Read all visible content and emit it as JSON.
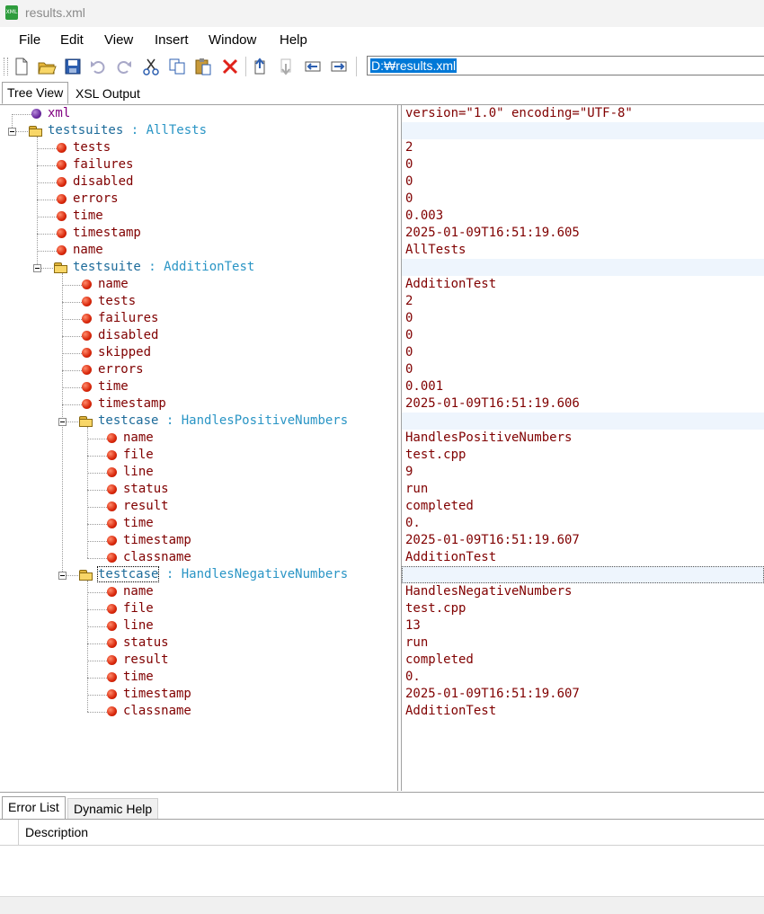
{
  "window": {
    "title": "results.xml",
    "icon": "xml-file-icon"
  },
  "menu": [
    "File",
    "Edit",
    "View",
    "Insert",
    "Window",
    "Help"
  ],
  "toolbar": {
    "buttons": [
      "new-file-icon",
      "open-folder-icon",
      "save-icon",
      "undo-icon",
      "redo-icon",
      "cut-icon",
      "copy-icon",
      "paste-icon",
      "delete-icon",
      "move-up-icon",
      "move-down-icon",
      "outdent-icon",
      "indent-icon"
    ],
    "path": "D:₩results.xml"
  },
  "tabs": {
    "tree_view": "Tree View",
    "xsl_output": "XSL Output"
  },
  "tree": [
    {
      "kind": "pi",
      "name": "xml",
      "type": "",
      "value": "version=\"1.0\" encoding=\"UTF-8\"",
      "level": 0
    },
    {
      "kind": "elem",
      "name": "testsuites",
      "type": ": AllTests",
      "value": "",
      "level": 0
    },
    {
      "kind": "attr",
      "name": "tests",
      "value": "2",
      "level": 1
    },
    {
      "kind": "attr",
      "name": "failures",
      "value": "0",
      "level": 1
    },
    {
      "kind": "attr",
      "name": "disabled",
      "value": "0",
      "level": 1
    },
    {
      "kind": "attr",
      "name": "errors",
      "value": "0",
      "level": 1
    },
    {
      "kind": "attr",
      "name": "time",
      "value": "0.003",
      "level": 1
    },
    {
      "kind": "attr",
      "name": "timestamp",
      "value": "2025-01-09T16:51:19.605",
      "level": 1
    },
    {
      "kind": "attr",
      "name": "name",
      "value": "AllTests",
      "level": 1
    },
    {
      "kind": "elem",
      "name": "testsuite",
      "type": ": AdditionTest",
      "value": "",
      "level": 1
    },
    {
      "kind": "attr",
      "name": "name",
      "value": "AdditionTest",
      "level": 2
    },
    {
      "kind": "attr",
      "name": "tests",
      "value": "2",
      "level": 2
    },
    {
      "kind": "attr",
      "name": "failures",
      "value": "0",
      "level": 2
    },
    {
      "kind": "attr",
      "name": "disabled",
      "value": "0",
      "level": 2
    },
    {
      "kind": "attr",
      "name": "skipped",
      "value": "0",
      "level": 2
    },
    {
      "kind": "attr",
      "name": "errors",
      "value": "0",
      "level": 2
    },
    {
      "kind": "attr",
      "name": "time",
      "value": "0.001",
      "level": 2
    },
    {
      "kind": "attr",
      "name": "timestamp",
      "value": "2025-01-09T16:51:19.606",
      "level": 2
    },
    {
      "kind": "elem",
      "name": "testcase",
      "type": ": HandlesPositiveNumbers",
      "value": "",
      "level": 2
    },
    {
      "kind": "attr",
      "name": "name",
      "value": "HandlesPositiveNumbers",
      "level": 3
    },
    {
      "kind": "attr",
      "name": "file",
      "value": "test.cpp",
      "level": 3
    },
    {
      "kind": "attr",
      "name": "line",
      "value": "9",
      "level": 3
    },
    {
      "kind": "attr",
      "name": "status",
      "value": "run",
      "level": 3
    },
    {
      "kind": "attr",
      "name": "result",
      "value": "completed",
      "level": 3
    },
    {
      "kind": "attr",
      "name": "time",
      "value": "0.",
      "level": 3
    },
    {
      "kind": "attr",
      "name": "timestamp",
      "value": "2025-01-09T16:51:19.607",
      "level": 3
    },
    {
      "kind": "attr",
      "name": "classname",
      "value": "AdditionTest",
      "level": 3
    },
    {
      "kind": "elem",
      "name": "testcase",
      "type": ": HandlesNegativeNumbers",
      "value": "",
      "level": 2,
      "focused": true
    },
    {
      "kind": "attr",
      "name": "name",
      "value": "HandlesNegativeNumbers",
      "level": 3
    },
    {
      "kind": "attr",
      "name": "file",
      "value": "test.cpp",
      "level": 3
    },
    {
      "kind": "attr",
      "name": "line",
      "value": "13",
      "level": 3
    },
    {
      "kind": "attr",
      "name": "status",
      "value": "run",
      "level": 3
    },
    {
      "kind": "attr",
      "name": "result",
      "value": "completed",
      "level": 3
    },
    {
      "kind": "attr",
      "name": "time",
      "value": "0.",
      "level": 3
    },
    {
      "kind": "attr",
      "name": "timestamp",
      "value": "2025-01-09T16:51:19.607",
      "level": 3
    },
    {
      "kind": "attr",
      "name": "classname",
      "value": "AdditionTest",
      "level": 3
    }
  ],
  "bottom_tabs": {
    "error_list": "Error List",
    "dynamic_help": "Dynamic Help"
  },
  "error_list": {
    "column": "Description"
  },
  "colors": {
    "attr_name": "#800000",
    "elem_name": "#1d6b9a",
    "elem_type": "#2a95c5",
    "pi_name": "#800080",
    "value": "#800000",
    "selection": "#0078d7",
    "band": "#eef5fd"
  }
}
